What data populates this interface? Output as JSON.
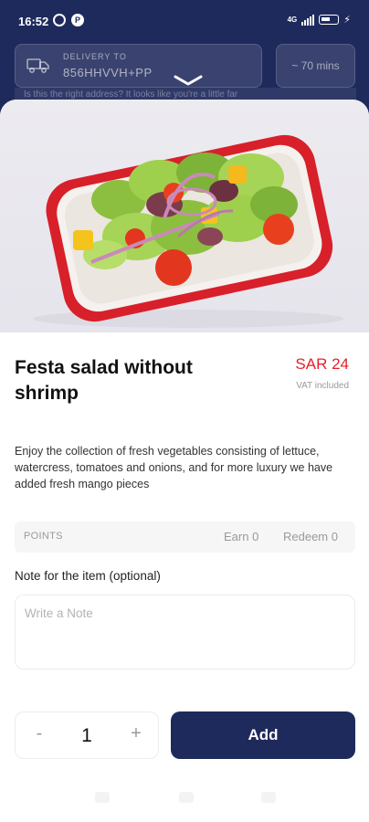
{
  "status_bar": {
    "time": "16:52",
    "network": "4G"
  },
  "delivery": {
    "label": "DELIVERY TO",
    "address": "856HHVVH+PP",
    "eta": "~ 70 mins",
    "warning": "Is this the right address? It looks like you're a little far"
  },
  "product": {
    "name": "Festa salad without shrimp",
    "price": "SAR 24",
    "vat_note": "VAT included",
    "description": "Enjoy the collection of fresh vegetables consisting of lettuce, watercress, tomatoes and onions, and for more luxury we have added fresh mango pieces"
  },
  "points": {
    "label": "POINTS",
    "earn": "Earn 0",
    "redeem": "Redeem 0"
  },
  "note": {
    "label": "Note for the item (optional)",
    "placeholder": "Write a Note",
    "value": ""
  },
  "quantity": {
    "minus": "-",
    "value": "1",
    "plus": "+"
  },
  "actions": {
    "add_label": "Add"
  },
  "colors": {
    "primary": "#1f2a5c",
    "price": "#e5202a"
  }
}
